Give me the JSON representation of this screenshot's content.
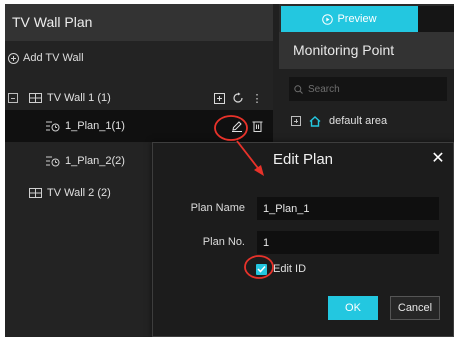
{
  "left_panel": {
    "title": "TV Wall Plan",
    "add_wall_label": "Add TV Wall",
    "tree": {
      "wall1_label": "TV Wall 1 (1)",
      "plan1_label": "1_Plan_1(1)",
      "plan2_label": "1_Plan_2(2)",
      "wall2_label": "TV Wall 2 (2)",
      "more_glyph": "⋮"
    }
  },
  "right_panel": {
    "tab_preview_label": "Preview",
    "header": "Monitoring Point",
    "search_placeholder": "Search",
    "area_label": "default area"
  },
  "dialog": {
    "title": "Edit Plan",
    "close_glyph": "✕",
    "plan_name_label": "Plan Name",
    "plan_name_value": "1_Plan_1",
    "plan_no_label": "Plan No.",
    "plan_no_value": "1",
    "edit_id_label": "Edit ID",
    "edit_id_checked": true,
    "ok_label": "OK",
    "cancel_label": "Cancel"
  },
  "colors": {
    "accent": "#23c7e0",
    "annotation": "#e8322a"
  },
  "icons": [
    "circle-plus-icon",
    "collapse-icon",
    "tv-wall-icon",
    "plan-icon",
    "add-box-icon",
    "refresh-icon",
    "more-icon",
    "edit-pencil-icon",
    "delete-icon",
    "play-circle-icon",
    "search-icon",
    "expand-icon",
    "home-icon",
    "close-icon",
    "checkbox-checked-icon"
  ]
}
